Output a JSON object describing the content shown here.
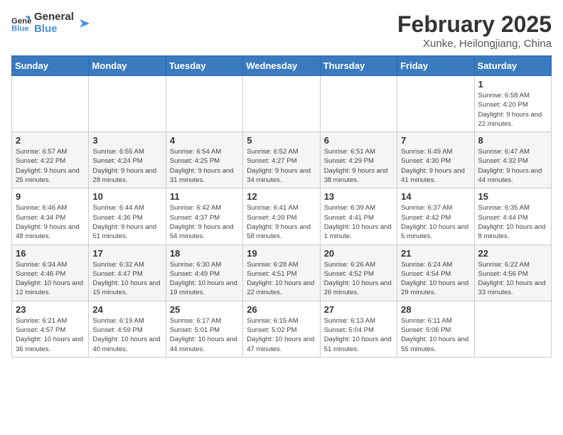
{
  "header": {
    "logo_general": "General",
    "logo_blue": "Blue",
    "month_year": "February 2025",
    "location": "Xunke, Heilongjiang, China"
  },
  "weekdays": [
    "Sunday",
    "Monday",
    "Tuesday",
    "Wednesday",
    "Thursday",
    "Friday",
    "Saturday"
  ],
  "weeks": [
    [
      {
        "day": "",
        "info": ""
      },
      {
        "day": "",
        "info": ""
      },
      {
        "day": "",
        "info": ""
      },
      {
        "day": "",
        "info": ""
      },
      {
        "day": "",
        "info": ""
      },
      {
        "day": "",
        "info": ""
      },
      {
        "day": "1",
        "info": "Sunrise: 6:58 AM\nSunset: 4:20 PM\nDaylight: 9 hours and 22 minutes."
      }
    ],
    [
      {
        "day": "2",
        "info": "Sunrise: 6:57 AM\nSunset: 4:22 PM\nDaylight: 9 hours and 25 minutes."
      },
      {
        "day": "3",
        "info": "Sunrise: 6:55 AM\nSunset: 4:24 PM\nDaylight: 9 hours and 28 minutes."
      },
      {
        "day": "4",
        "info": "Sunrise: 6:54 AM\nSunset: 4:25 PM\nDaylight: 9 hours and 31 minutes."
      },
      {
        "day": "5",
        "info": "Sunrise: 6:52 AM\nSunset: 4:27 PM\nDaylight: 9 hours and 34 minutes."
      },
      {
        "day": "6",
        "info": "Sunrise: 6:51 AM\nSunset: 4:29 PM\nDaylight: 9 hours and 38 minutes."
      },
      {
        "day": "7",
        "info": "Sunrise: 6:49 AM\nSunset: 4:30 PM\nDaylight: 9 hours and 41 minutes."
      },
      {
        "day": "8",
        "info": "Sunrise: 6:47 AM\nSunset: 4:32 PM\nDaylight: 9 hours and 44 minutes."
      }
    ],
    [
      {
        "day": "9",
        "info": "Sunrise: 6:46 AM\nSunset: 4:34 PM\nDaylight: 9 hours and 48 minutes."
      },
      {
        "day": "10",
        "info": "Sunrise: 6:44 AM\nSunset: 4:36 PM\nDaylight: 9 hours and 51 minutes."
      },
      {
        "day": "11",
        "info": "Sunrise: 6:42 AM\nSunset: 4:37 PM\nDaylight: 9 hours and 54 minutes."
      },
      {
        "day": "12",
        "info": "Sunrise: 6:41 AM\nSunset: 4:39 PM\nDaylight: 9 hours and 58 minutes."
      },
      {
        "day": "13",
        "info": "Sunrise: 6:39 AM\nSunset: 4:41 PM\nDaylight: 10 hours and 1 minute."
      },
      {
        "day": "14",
        "info": "Sunrise: 6:37 AM\nSunset: 4:42 PM\nDaylight: 10 hours and 5 minutes."
      },
      {
        "day": "15",
        "info": "Sunrise: 6:35 AM\nSunset: 4:44 PM\nDaylight: 10 hours and 8 minutes."
      }
    ],
    [
      {
        "day": "16",
        "info": "Sunrise: 6:34 AM\nSunset: 4:46 PM\nDaylight: 10 hours and 12 minutes."
      },
      {
        "day": "17",
        "info": "Sunrise: 6:32 AM\nSunset: 4:47 PM\nDaylight: 10 hours and 15 minutes."
      },
      {
        "day": "18",
        "info": "Sunrise: 6:30 AM\nSunset: 4:49 PM\nDaylight: 10 hours and 19 minutes."
      },
      {
        "day": "19",
        "info": "Sunrise: 6:28 AM\nSunset: 4:51 PM\nDaylight: 10 hours and 22 minutes."
      },
      {
        "day": "20",
        "info": "Sunrise: 6:26 AM\nSunset: 4:52 PM\nDaylight: 10 hours and 26 minutes."
      },
      {
        "day": "21",
        "info": "Sunrise: 6:24 AM\nSunset: 4:54 PM\nDaylight: 10 hours and 29 minutes."
      },
      {
        "day": "22",
        "info": "Sunrise: 6:22 AM\nSunset: 4:56 PM\nDaylight: 10 hours and 33 minutes."
      }
    ],
    [
      {
        "day": "23",
        "info": "Sunrise: 6:21 AM\nSunset: 4:57 PM\nDaylight: 10 hours and 36 minutes."
      },
      {
        "day": "24",
        "info": "Sunrise: 6:19 AM\nSunset: 4:59 PM\nDaylight: 10 hours and 40 minutes."
      },
      {
        "day": "25",
        "info": "Sunrise: 6:17 AM\nSunset: 5:01 PM\nDaylight: 10 hours and 44 minutes."
      },
      {
        "day": "26",
        "info": "Sunrise: 6:15 AM\nSunset: 5:02 PM\nDaylight: 10 hours and 47 minutes."
      },
      {
        "day": "27",
        "info": "Sunrise: 6:13 AM\nSunset: 5:04 PM\nDaylight: 10 hours and 51 minutes."
      },
      {
        "day": "28",
        "info": "Sunrise: 6:11 AM\nSunset: 5:06 PM\nDaylight: 10 hours and 55 minutes."
      },
      {
        "day": "",
        "info": ""
      }
    ]
  ]
}
